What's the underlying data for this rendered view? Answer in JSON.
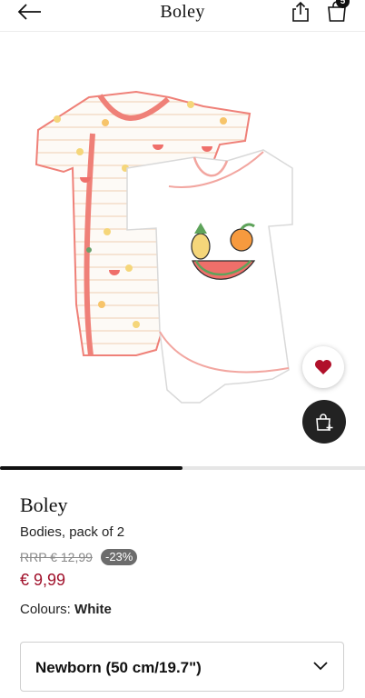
{
  "header": {
    "brand": "Boley",
    "cart_count": "5",
    "icons": [
      "back-arrow-icon",
      "share-icon",
      "shopping-bag-icon"
    ]
  },
  "gallery": {
    "image_subject": "two baby bodysuits with fruit print",
    "progress": 0.5
  },
  "product": {
    "brand": "Boley",
    "name": "Bodies, pack of 2",
    "rrp": "RRP € 12,99",
    "discount": "-23%",
    "price": "€ 9,99",
    "colours_label": "Colours:",
    "colour_value": "White"
  },
  "size": {
    "selected": "Newborn (50 cm/19.7\")"
  },
  "actions": {
    "favorite_icon": "heart-icon",
    "add_to_cart_icon": "bag-plus-icon"
  },
  "colors": {
    "price": "#a0102a",
    "badge": "#6c6c6c",
    "heart": "#b0102a",
    "pink_trim": "#ef8078"
  }
}
